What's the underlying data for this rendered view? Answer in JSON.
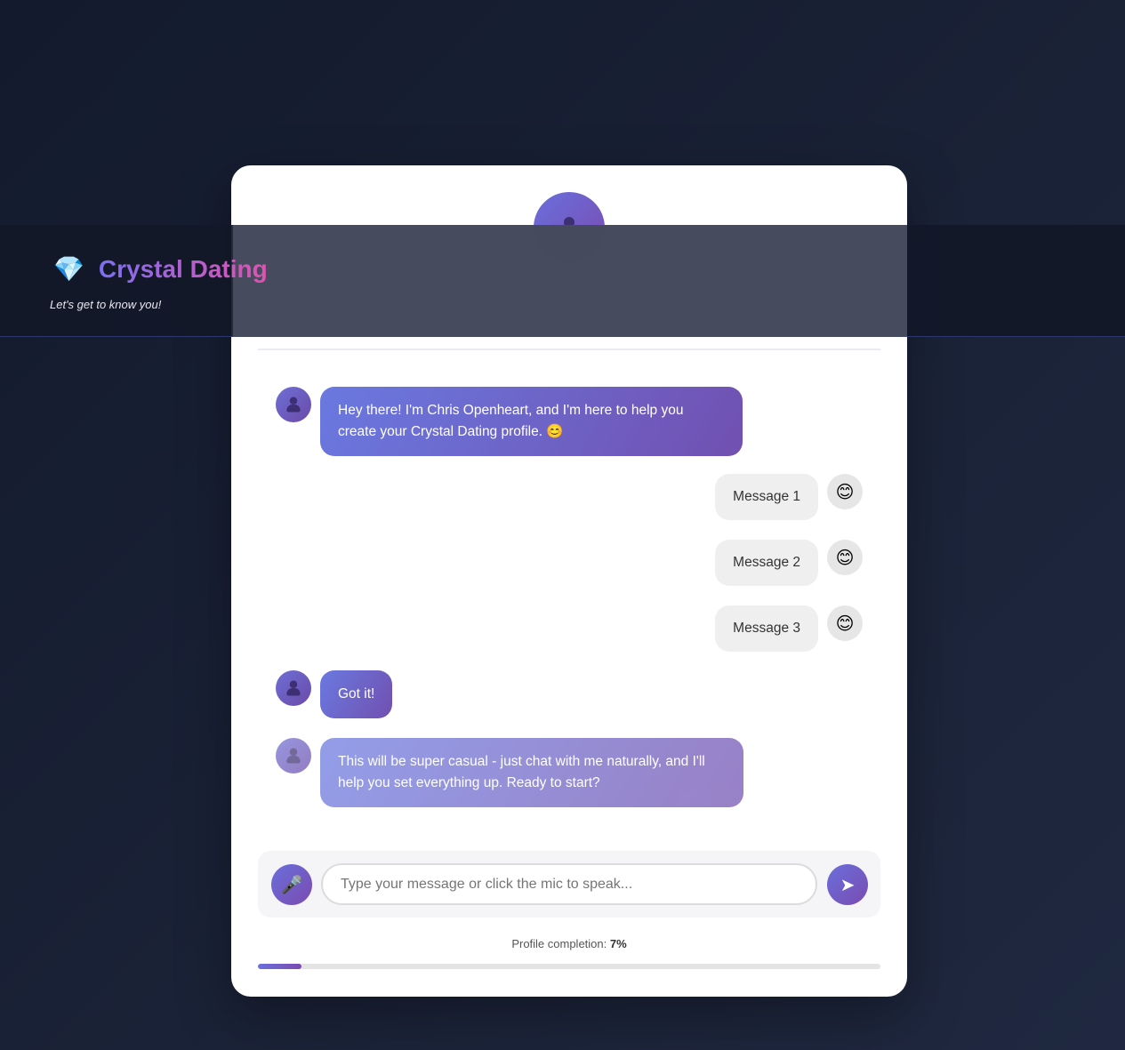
{
  "app": {
    "title": "Crystal Dating",
    "brand_icon": "gem-icon",
    "tagline": "Let's get to know you!"
  },
  "chat": {
    "messages": [
      {
        "sender": "bot",
        "text": "Hey there! I'm Chris Openheart, and I'm here to help you create your Crystal Dating profile. 😊"
      },
      {
        "sender": "user",
        "text": "Message 1",
        "avatar": "😊"
      },
      {
        "sender": "user",
        "text": "Message 2",
        "avatar": "😊"
      },
      {
        "sender": "user",
        "text": "Message 3",
        "avatar": "😊"
      },
      {
        "sender": "bot",
        "text": "Got it!"
      },
      {
        "sender": "bot",
        "text": "This will be super casual - just chat with me naturally, and I'll help you set everything up. Ready to start?"
      }
    ]
  },
  "input": {
    "placeholder": "Type your message or click the mic to speak...",
    "mic_icon": "🎤",
    "send_icon": "➤"
  },
  "progress": {
    "label": "Profile completion: ",
    "value_text": "7%",
    "value": 0.07
  },
  "colors": {
    "accent_start": "#6a6fdc",
    "accent_end": "#7a4bb0",
    "title_gradient_start": "#7d6ff0",
    "title_gradient_end": "#e052b0",
    "background": "#161d31"
  }
}
